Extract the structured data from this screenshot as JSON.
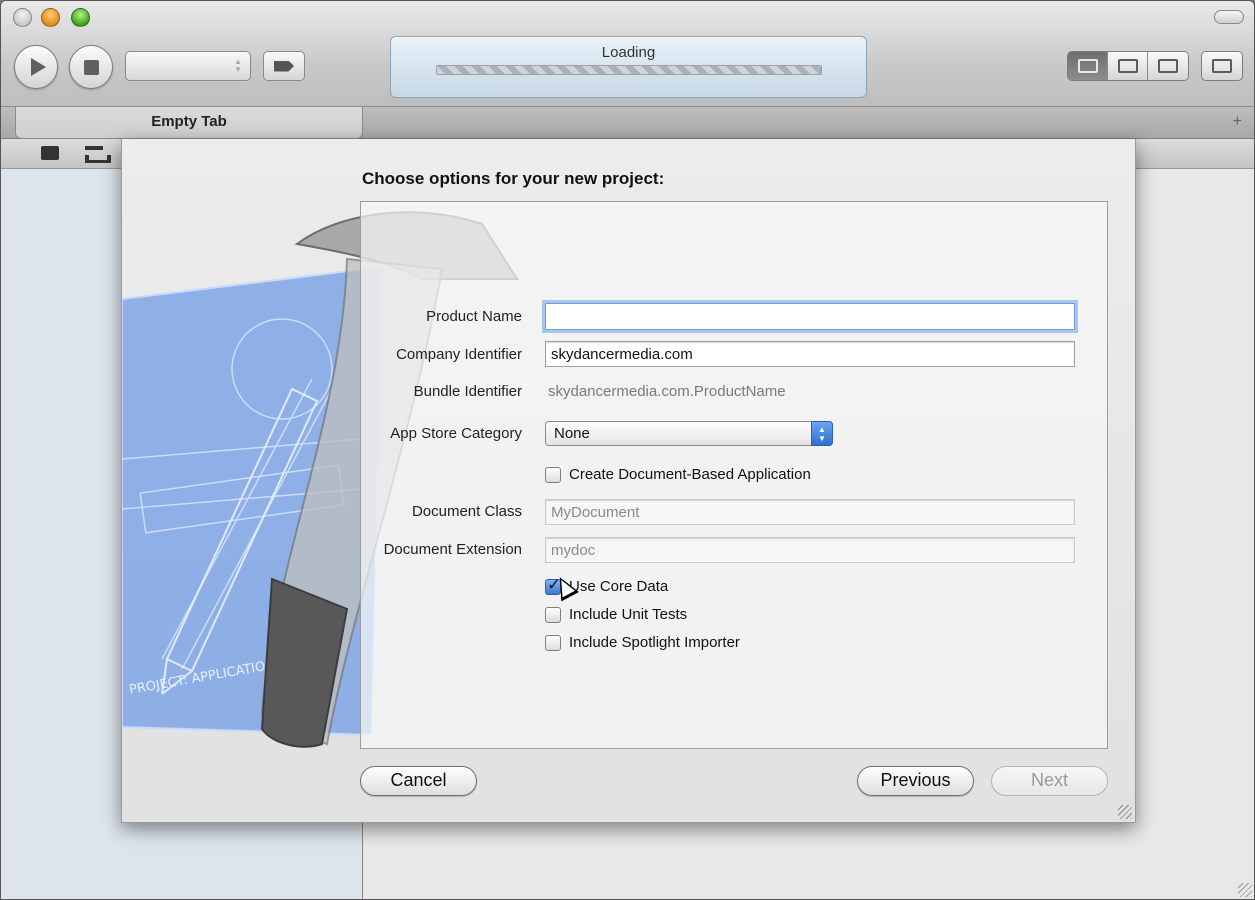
{
  "window": {
    "activity_status": "Loading",
    "tab_label": "Empty Tab",
    "tab_add_symbol": "+",
    "progress_indeterminate": true
  },
  "toolbar": {
    "run_icon": "play-icon",
    "stop_icon": "stop-icon",
    "scheme_value": "",
    "breakpoints_icon": "breakpoint-icon",
    "editor_modes": [
      "standard-editor-icon",
      "assistant-editor-icon",
      "version-editor-icon"
    ],
    "editor_active_index": 0,
    "view_toggles": [
      "navigator-toggle-icon",
      "debug-area-toggle-icon",
      "utilities-toggle-icon"
    ],
    "view_active_index": 0,
    "organizer_icon": "organizer-icon"
  },
  "sheet": {
    "title": "Choose options for your new project:",
    "form": {
      "product_name": {
        "label": "Product Name",
        "value": ""
      },
      "company_identifier": {
        "label": "Company Identifier",
        "value": "skydancermedia.com"
      },
      "bundle_identifier": {
        "label": "Bundle Identifier",
        "value": "skydancermedia.com.ProductName"
      },
      "app_store_category": {
        "label": "App Store Category",
        "value": "None"
      },
      "document_based": {
        "label": "Create Document-Based Application",
        "checked": false
      },
      "document_class": {
        "label": "Document Class",
        "value": "MyDocument"
      },
      "document_extension": {
        "label": "Document Extension",
        "value": "mydoc"
      },
      "use_core_data": {
        "label": "Use Core Data",
        "checked": true
      },
      "unit_tests": {
        "label": "Include Unit Tests",
        "checked": false
      },
      "spotlight_importer": {
        "label": "Include Spotlight Importer",
        "checked": false
      }
    },
    "buttons": {
      "cancel": "Cancel",
      "previous": "Previous",
      "next": "Next"
    },
    "art_icons": [
      "hammer-icon",
      "blueprint-icon"
    ],
    "blueprint_text": "PROJECT: APPLICATION.APP"
  },
  "colors": {
    "focus_ring": "#a7c7ee",
    "select_accent": "#2f6fd3",
    "navigator_bg": "#dde4ec"
  }
}
